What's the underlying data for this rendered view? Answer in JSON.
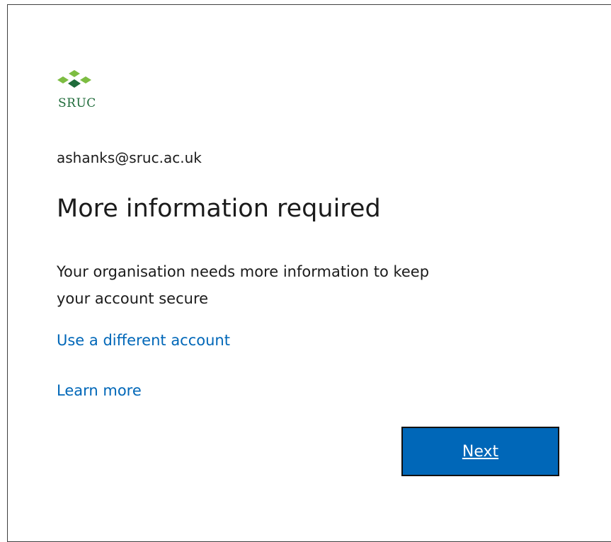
{
  "brand": {
    "logo_text": "SRUC",
    "logo_icon": "sruc-diamond-logo",
    "colors": {
      "logo_light": "#7dbd42",
      "logo_dark": "#1f6b3a"
    }
  },
  "account": {
    "email": "ashanks@sruc.ac.uk"
  },
  "content": {
    "title": "More information required",
    "description_line1": "Your organisation needs more information to keep",
    "description_line2": "your account secure"
  },
  "links": {
    "different_account": "Use a different account",
    "learn_more": "Learn more"
  },
  "actions": {
    "next_label": "Next"
  },
  "colors": {
    "accent": "#0067b8",
    "text": "#1b1b1b"
  }
}
